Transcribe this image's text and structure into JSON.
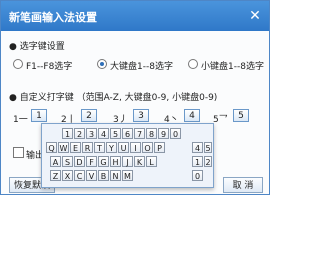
{
  "title": "新笔画输入法设置",
  "close_glyph": "✕",
  "select_key": {
    "heading": "● 选字键设置",
    "options": [
      "F1--F8选字",
      "大键盘1--8选字",
      "小键盘1--8选字"
    ],
    "selected_index": 1
  },
  "custom_keys": {
    "heading": "● 自定义打字键 （范围A-Z, 大键盘0-9, 小键盘0-9)",
    "strokes": [
      {
        "label": "1一",
        "value": "1"
      },
      {
        "label": "2丨",
        "value": "2"
      },
      {
        "label": "3丿",
        "value": "3"
      },
      {
        "label": "4丶",
        "value": "4"
      },
      {
        "label": "5乛",
        "value": "5"
      }
    ]
  },
  "output_checkbox_label": "输出",
  "restore_button": "恢复默认",
  "cancel_button": "取 消",
  "keyboard": {
    "row1": [
      "1",
      "2",
      "3",
      "4",
      "5",
      "6",
      "7",
      "8",
      "9",
      "0"
    ],
    "row2": [
      "Q",
      "W",
      "E",
      "R",
      "T",
      "Y",
      "U",
      "I",
      "O",
      "P"
    ],
    "row3": [
      "A",
      "S",
      "D",
      "F",
      "G",
      "H",
      "J",
      "K",
      "L"
    ],
    "row4": [
      "Z",
      "X",
      "C",
      "V",
      "B",
      "N",
      "M"
    ],
    "numpad": [
      "4",
      "5",
      "6",
      "1",
      "2",
      "3",
      "0"
    ]
  },
  "colors": {
    "titlebar": "#3a86d4",
    "accent": "#2f6fb8"
  }
}
